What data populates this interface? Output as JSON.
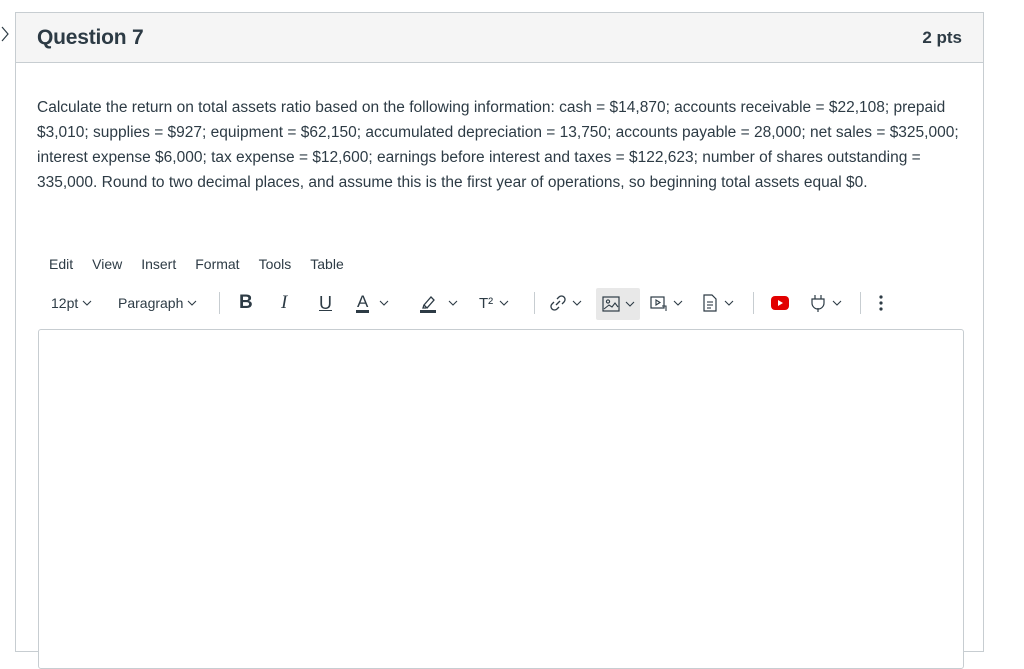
{
  "question": {
    "title": "Question 7",
    "points": "2 pts",
    "text": "Calculate the return on total assets ratio based on the following information: cash = $14,870; accounts receivable = $22,108; prepaid $3,010; supplies = $927; equipment = $62,150; accumulated depreciation = 13,750; accounts payable = 28,000; net sales = $325,000; interest expense $6,000; tax expense = $12,600; earnings before interest and taxes = $122,623; number of shares outstanding = 335,000. Round to two decimal places, and assume this is the first year of operations, so beginning total assets equal $0."
  },
  "editor": {
    "menu": [
      "Edit",
      "View",
      "Insert",
      "Format",
      "Tools",
      "Table"
    ],
    "font_size": "12pt",
    "block_format": "Paragraph",
    "toolbar_icons": [
      "bold-icon",
      "italic-icon",
      "underline-icon",
      "text-color-icon",
      "highlight-color-icon",
      "superscript-icon",
      "link-icon",
      "image-icon",
      "media-icon",
      "document-icon",
      "youtube-icon",
      "apps-plugin-icon",
      "more-icon"
    ],
    "bold_glyph": "B",
    "italic_glyph": "I",
    "underline_glyph": "U",
    "text_color_glyph": "A",
    "superscript_glyph": "T²",
    "accent_red": "#e20000",
    "highlight_button_bg": "#e8e8e8"
  }
}
